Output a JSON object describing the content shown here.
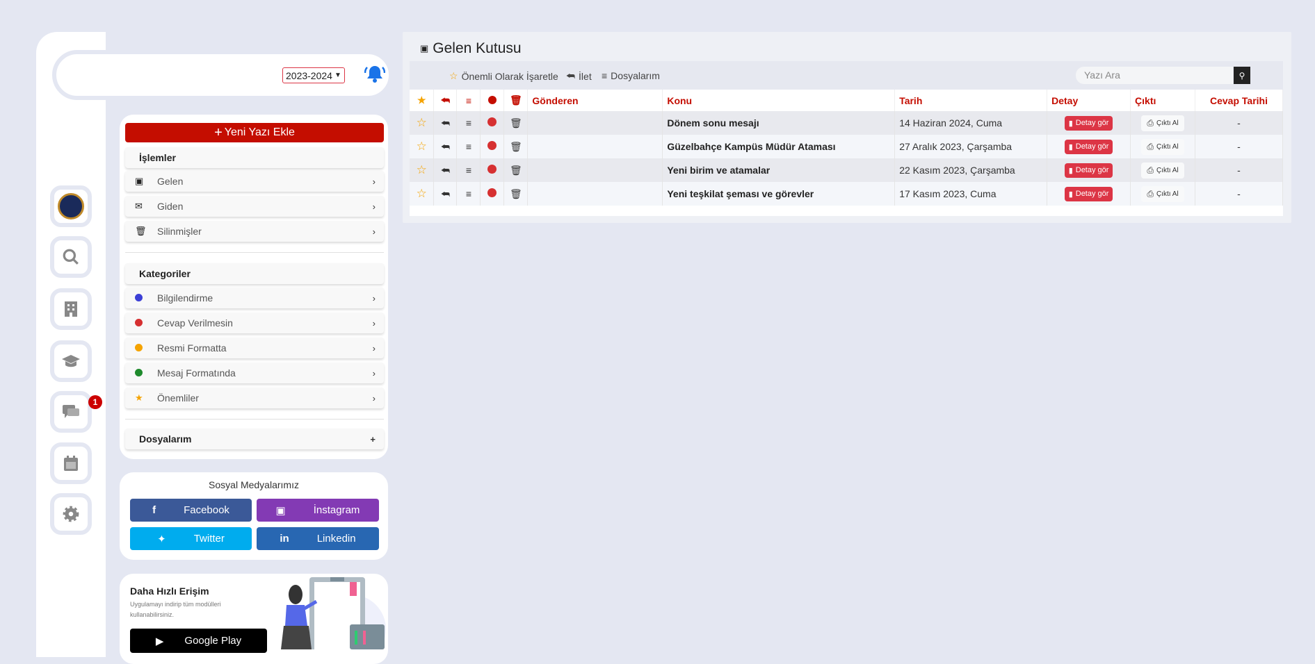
{
  "header": {
    "year_select": "2023-2024"
  },
  "rail": {
    "badge": "1",
    "icons": [
      "university-logo-icon",
      "search-icon",
      "building-icon",
      "graduation-cap-icon",
      "chat-icon",
      "calendar-icon",
      "gear-icon"
    ]
  },
  "sidebar": {
    "new_button": "Yeni Yazı Ekle",
    "operations_title": "İşlemler",
    "operations": [
      {
        "label": "Gelen",
        "icon": "inbox-icon"
      },
      {
        "label": "Giden",
        "icon": "envelope-icon"
      },
      {
        "label": "Silinmişler",
        "icon": "trash-icon"
      }
    ],
    "categories_title": "Kategoriler",
    "categories": [
      {
        "label": "Bilgilendirme",
        "color": "#3c3fd6"
      },
      {
        "label": "Cevap Verilmesin",
        "color": "#d63031"
      },
      {
        "label": "Resmi Formatta",
        "color": "#f5a300"
      },
      {
        "label": "Mesaj Formatında",
        "color": "#1e8a2c"
      },
      {
        "label": "Önemliler",
        "color": "#f5a300",
        "icon": "star-icon"
      }
    ],
    "files_title": "Dosyalarım"
  },
  "social": {
    "title": "Sosyal Medyalarımız",
    "buttons": [
      {
        "label": "Facebook",
        "color": "#3b5998"
      },
      {
        "label": "İnstagram",
        "color": "#833ab4"
      },
      {
        "label": "Twitter",
        "color": "#00acee"
      },
      {
        "label": "Linkedin",
        "color": "#2867b2"
      }
    ]
  },
  "app": {
    "title": "Daha Hızlı Erişim",
    "desc": "Uygulamayı indirip tüm modülleri kullanabilirsiniz.",
    "button": "Google Play"
  },
  "main": {
    "title": "Gelen Kutusu",
    "toolbar": {
      "mark": "Önemli Olarak İşaretle",
      "forward": "İlet",
      "files": "Dosyalarım"
    },
    "search_placeholder": "Yazı Ara",
    "columns": [
      "Gönderen",
      "Konu",
      "Tarih",
      "Detay",
      "Çıktı",
      "Cevap Tarihi"
    ],
    "rows": [
      {
        "sender": "",
        "subject": "Dönem sonu mesajı",
        "date": "14 Haziran 2024, Cuma",
        "detail": "Detay gör",
        "print": "Çıktı Al",
        "reply_date": "-"
      },
      {
        "sender": "",
        "subject": "Güzelbahçe Kampüs Müdür Ataması",
        "date": "27 Aralık 2023, Çarşamba",
        "detail": "Detay gör",
        "print": "Çıktı Al",
        "reply_date": "-"
      },
      {
        "sender": "",
        "subject": "Yeni birim ve atamalar",
        "date": "22 Kasım 2023, Çarşamba",
        "detail": "Detay gör",
        "print": "Çıktı Al",
        "reply_date": "-"
      },
      {
        "sender": "",
        "subject": "Yeni teşkilat şeması ve görevler",
        "date": "17 Kasım 2023, Cuma",
        "detail": "Detay gör",
        "print": "Çıktı Al",
        "reply_date": "-"
      }
    ]
  }
}
